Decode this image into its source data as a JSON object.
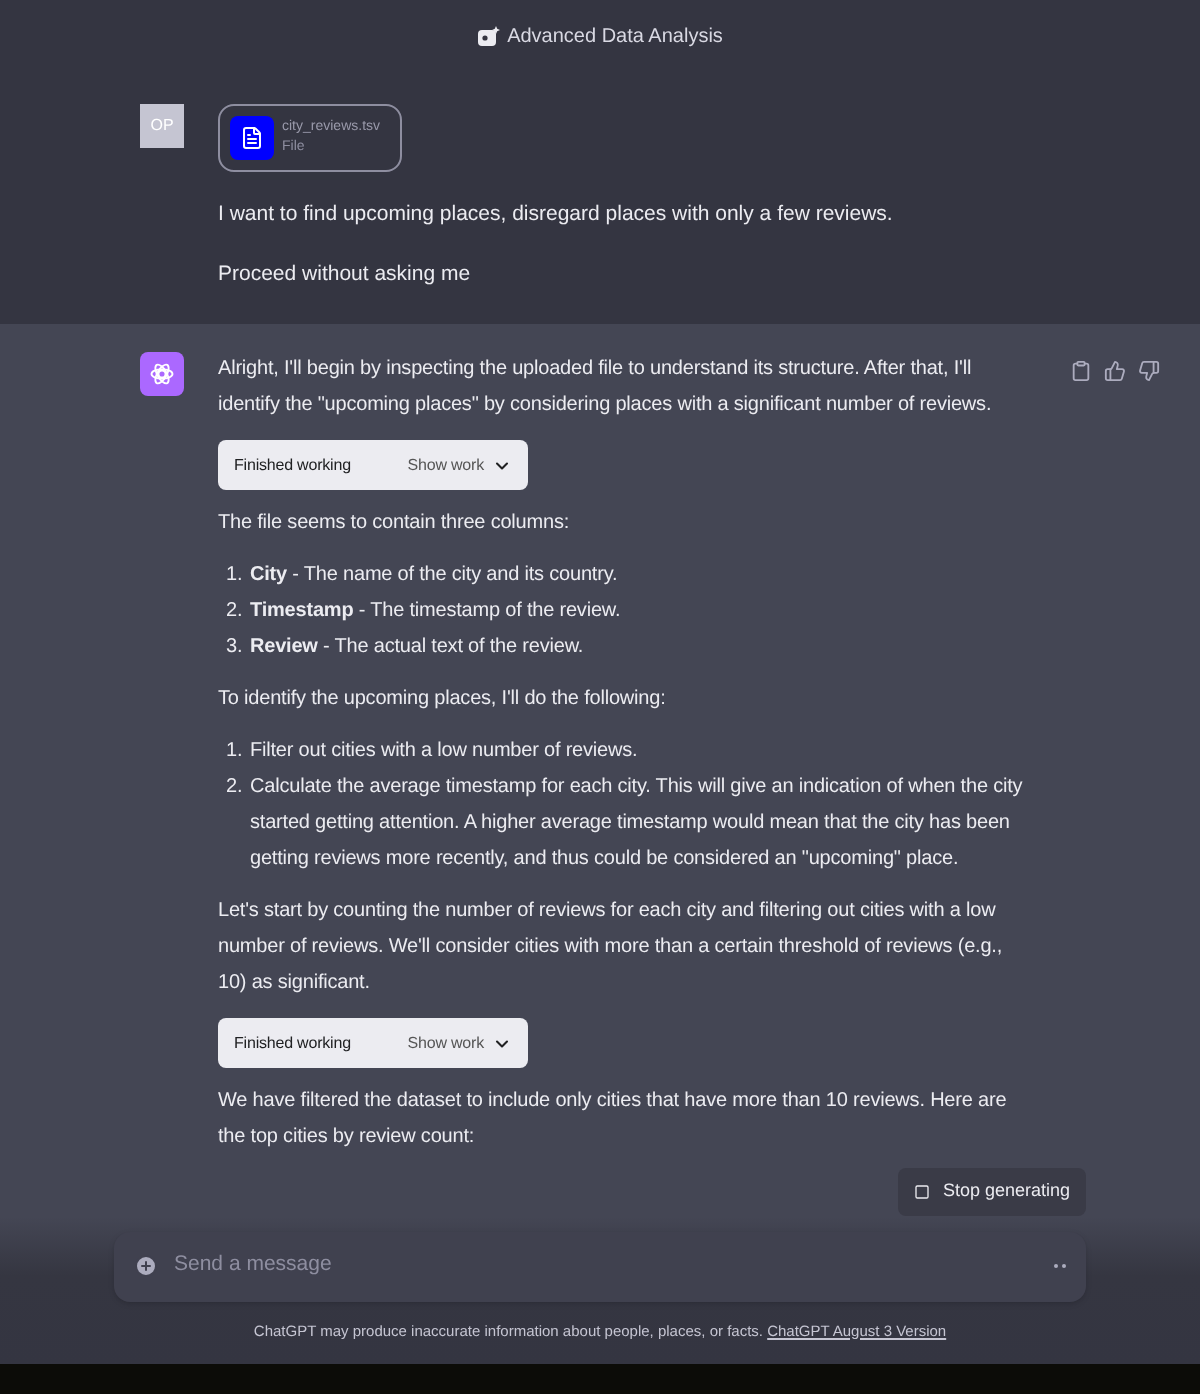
{
  "header": {
    "title": "Advanced Data Analysis"
  },
  "user_message": {
    "avatar": "OP",
    "file": {
      "name": "city_reviews.tsv",
      "type": "File"
    },
    "paragraphs": [
      "I want to find upcoming places, disregard places with only a few reviews.",
      "Proceed without asking me"
    ]
  },
  "assistant_message": {
    "blocks": [
      {
        "kind": "text",
        "text": "Alright, I'll begin by inspecting the uploaded file to understand its structure. After that, I'll identify the \"upcoming places\" by considering places with a significant number of reviews."
      },
      {
        "kind": "work",
        "status": "Finished working",
        "action": "Show work"
      },
      {
        "kind": "text",
        "text": "The file seems to contain three columns:"
      },
      {
        "kind": "list",
        "items": [
          {
            "number": "1.",
            "text": "**City** - The name of the city and its country."
          },
          {
            "number": "2.",
            "text": "**Timestamp** - The timestamp of the review."
          },
          {
            "number": "3.",
            "text": "**Review** - The actual text of the review."
          }
        ]
      },
      {
        "kind": "text",
        "text": "To identify the upcoming places, I'll do the following:"
      },
      {
        "kind": "list",
        "items": [
          {
            "number": "1.",
            "text": "Filter out cities with a low number of reviews."
          },
          {
            "number": "2.",
            "text": "Calculate the average timestamp for each city. This will give an indication of when the city started getting attention. A higher average timestamp would mean that the city has been getting reviews more recently, and thus could be considered an \"upcoming\" place."
          }
        ]
      },
      {
        "kind": "text",
        "text": "Let's start by counting the number of reviews for each city and filtering out cities with a low number of reviews. We'll consider cities with more than a certain threshold of reviews (e.g., 10) as significant."
      },
      {
        "kind": "work",
        "status": "Finished working",
        "action": "Show work"
      },
      {
        "kind": "text",
        "text": "We have filtered the dataset to include only cities that have more than 10 reviews. Here are the top cities by review count:"
      }
    ]
  },
  "stop_button": "Stop generating",
  "composer": {
    "placeholder": "Send a message"
  },
  "footer": {
    "text": "ChatGPT may produce inaccurate information about people, places, or facts.",
    "link": "ChatGPT August 3 Version"
  }
}
